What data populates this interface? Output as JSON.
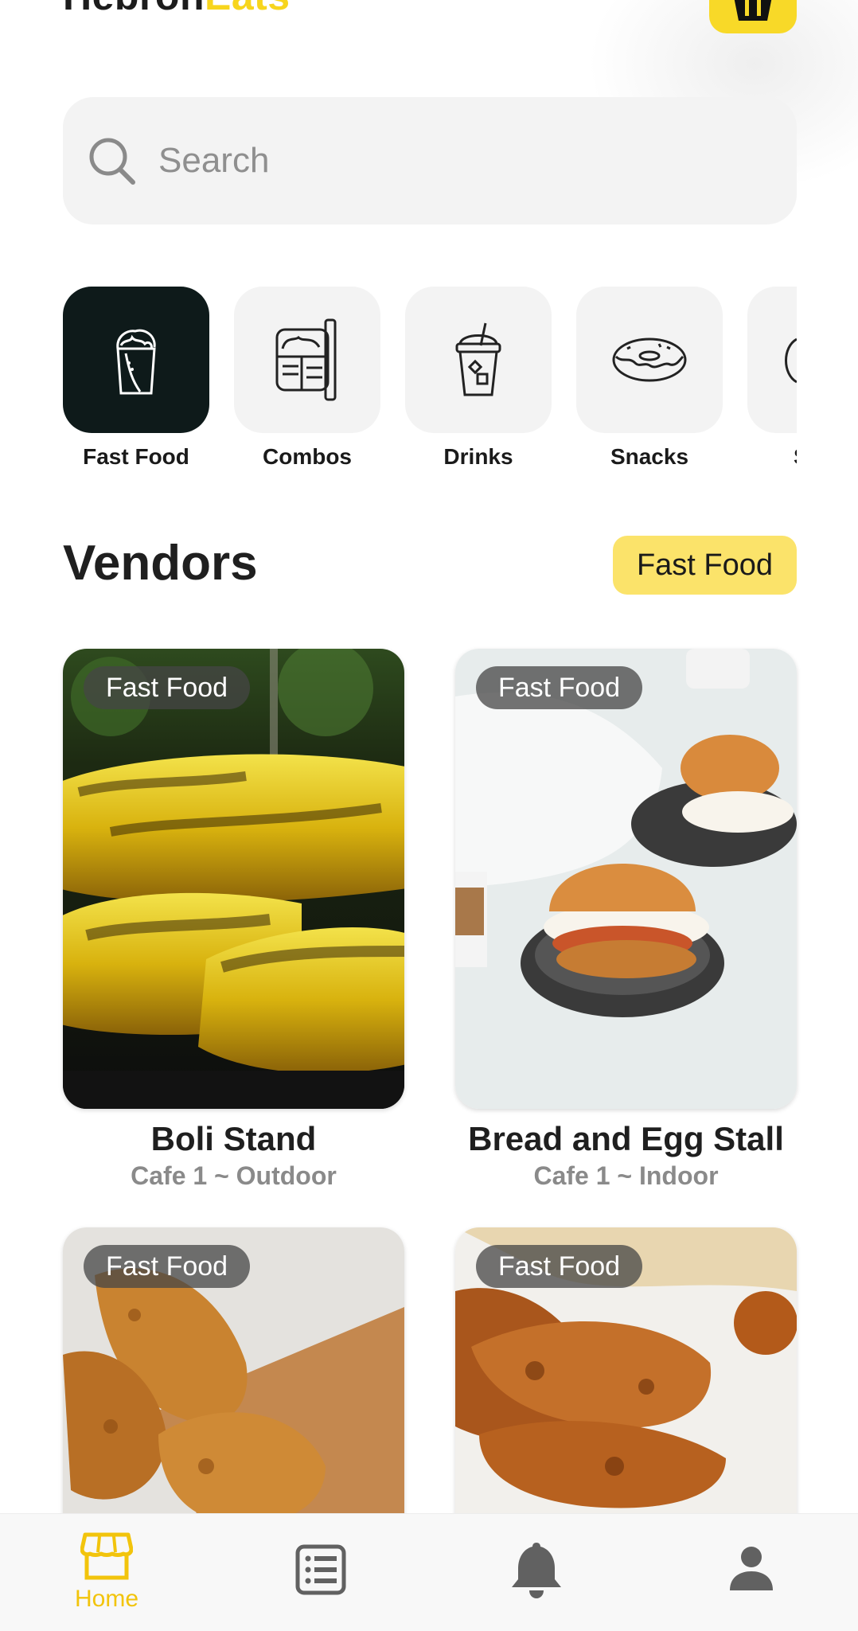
{
  "header": {
    "app_name_main": "HebronEats",
    "app_name_part1": "Hebron",
    "app_name_part2": "Eats",
    "accent_color": "#f7d51d",
    "cart_icon": "basket-icon"
  },
  "search": {
    "placeholder": "Search",
    "icon": "search-icon"
  },
  "categories": [
    {
      "label": "Fast Food",
      "icon": "wrap-icon",
      "active": true
    },
    {
      "label": "Combos",
      "icon": "lunchbox-icon",
      "active": false
    },
    {
      "label": "Drinks",
      "icon": "cup-icon",
      "active": false
    },
    {
      "label": "Snacks",
      "icon": "donut-icon",
      "active": false
    },
    {
      "label": "S",
      "icon": "more-icon",
      "active": false
    }
  ],
  "vendors": {
    "title": "Vendors",
    "filter": "Fast Food",
    "items": [
      {
        "badge": "Fast Food",
        "name": "Boli Stand",
        "location": "Cafe 1 ~ Outdoor"
      },
      {
        "badge": "Fast Food",
        "name": "Bread and Egg Stall",
        "location": "Cafe 1 ~ Indoor"
      },
      {
        "badge": "Fast Food",
        "name": "",
        "location": ""
      },
      {
        "badge": "Fast Food",
        "name": "",
        "location": ""
      }
    ]
  },
  "nav": {
    "items": [
      {
        "label": "Home",
        "icon": "store-icon",
        "active": true
      },
      {
        "label": "",
        "icon": "list-icon",
        "active": false
      },
      {
        "label": "",
        "icon": "bell-icon",
        "active": false
      },
      {
        "label": "",
        "icon": "person-icon",
        "active": false
      }
    ],
    "active_color": "#f2c40c",
    "inactive_color": "#616161"
  }
}
